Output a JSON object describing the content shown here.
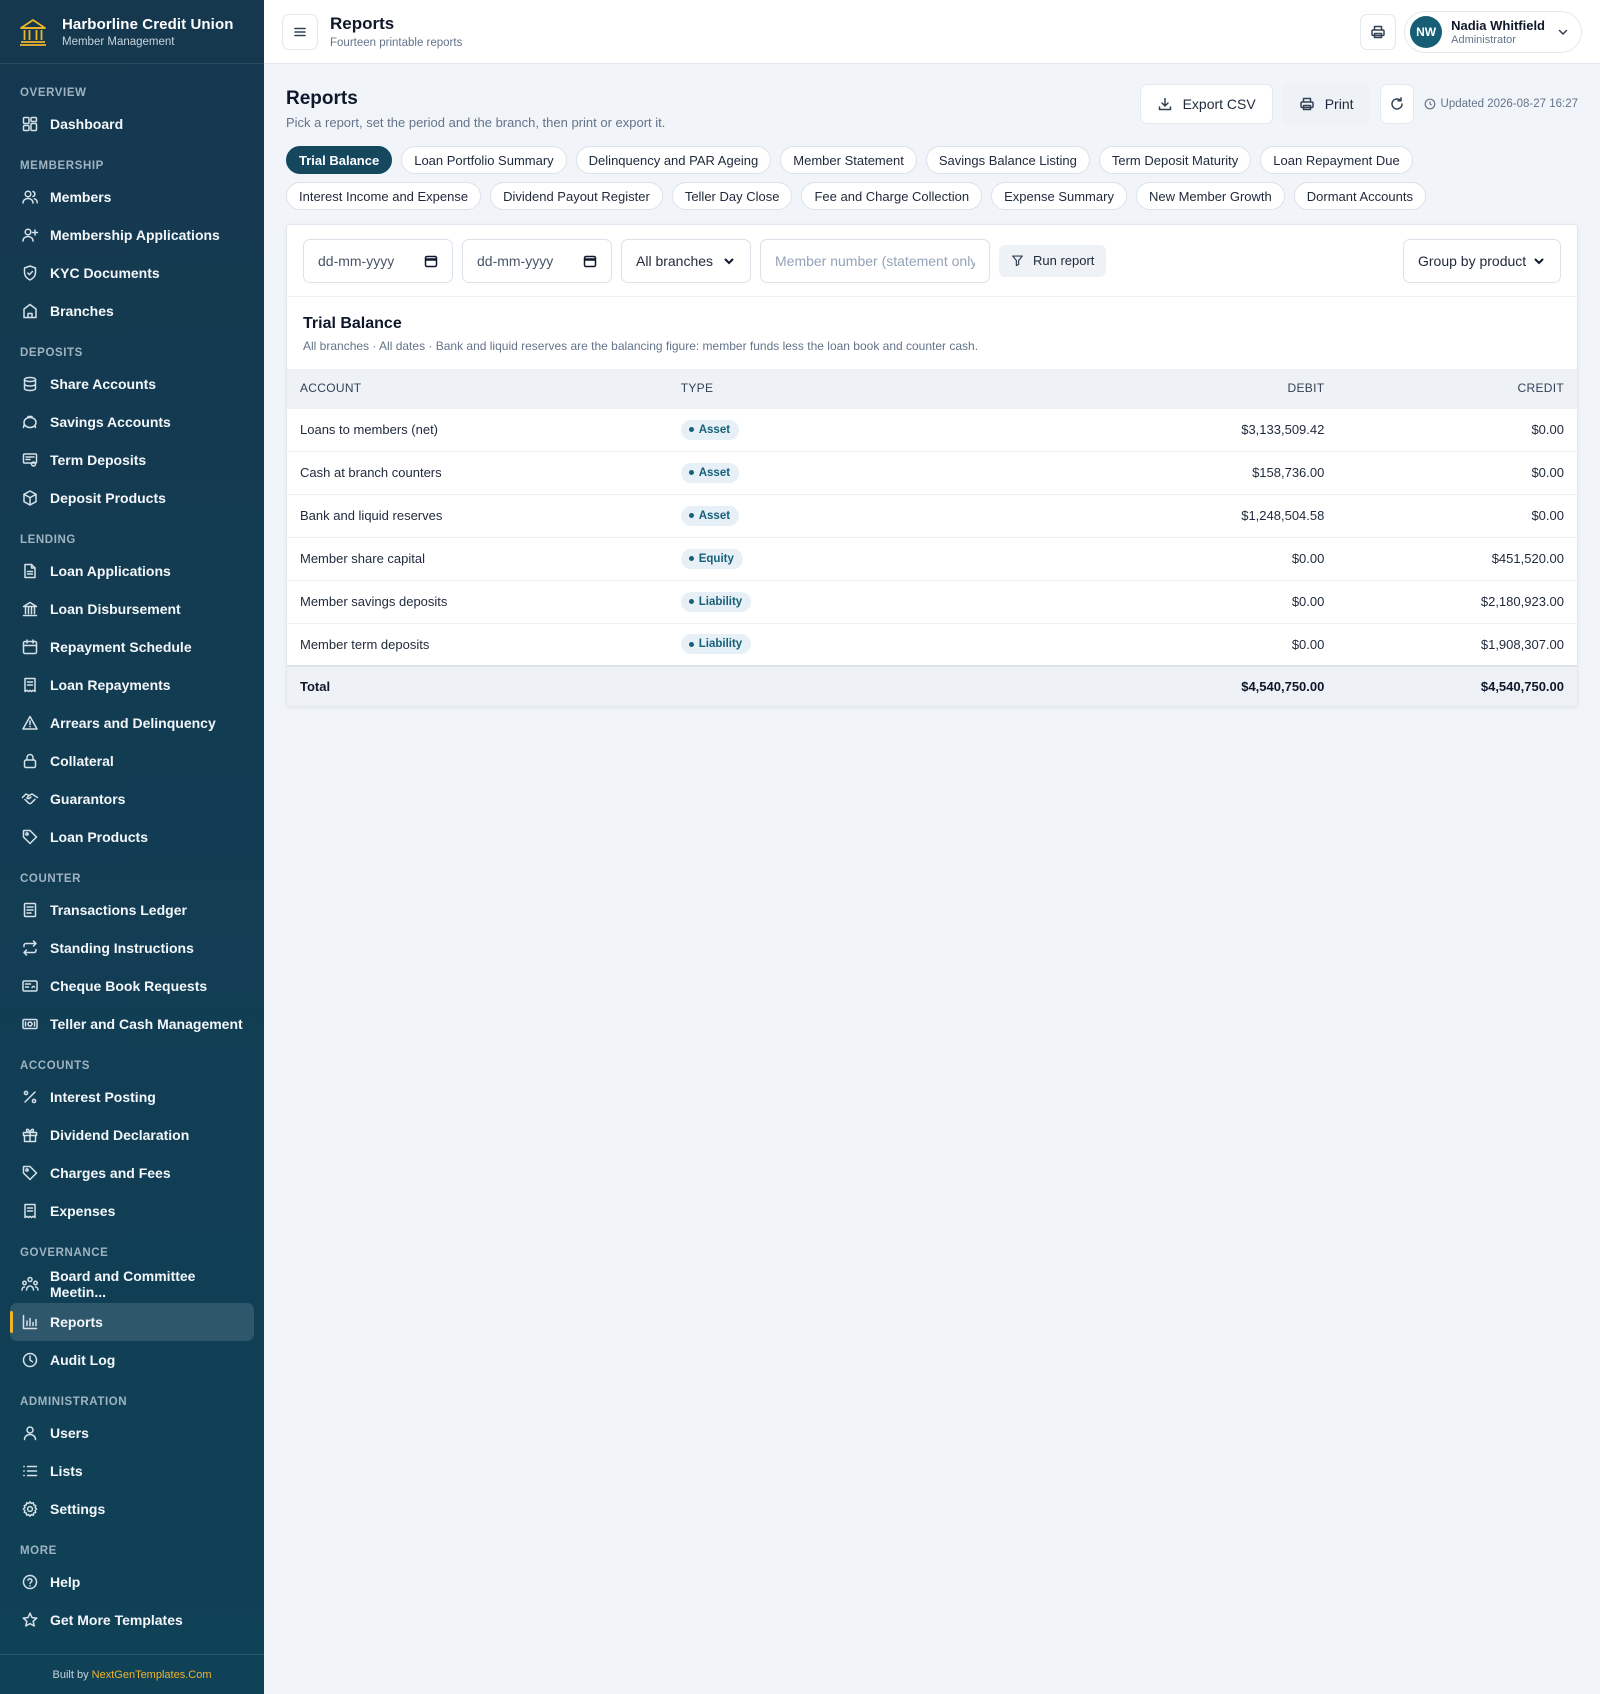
{
  "brand": {
    "name": "Harborline Credit Union",
    "subtitle": "Member Management"
  },
  "nav": [
    {
      "title": "Overview",
      "items": [
        {
          "label": "Dashboard",
          "icon": "dashboard-icon"
        }
      ]
    },
    {
      "title": "Membership",
      "items": [
        {
          "label": "Members",
          "icon": "users-icon"
        },
        {
          "label": "Membership Applications",
          "icon": "user-plus-icon"
        },
        {
          "label": "KYC Documents",
          "icon": "shield-icon"
        },
        {
          "label": "Branches",
          "icon": "building-icon"
        }
      ]
    },
    {
      "title": "Deposits",
      "items": [
        {
          "label": "Share Accounts",
          "icon": "database-icon"
        },
        {
          "label": "Savings Accounts",
          "icon": "piggy-bank-icon"
        },
        {
          "label": "Term Deposits",
          "icon": "certificate-icon"
        },
        {
          "label": "Deposit Products",
          "icon": "package-icon"
        }
      ]
    },
    {
      "title": "Lending",
      "items": [
        {
          "label": "Loan Applications",
          "icon": "file-icon"
        },
        {
          "label": "Loan Disbursement",
          "icon": "bank-icon"
        },
        {
          "label": "Repayment Schedule",
          "icon": "calendar-icon"
        },
        {
          "label": "Loan Repayments",
          "icon": "receipt-icon"
        },
        {
          "label": "Arrears and Delinquency",
          "icon": "alert-triangle-icon"
        },
        {
          "label": "Collateral",
          "icon": "lock-icon"
        },
        {
          "label": "Guarantors",
          "icon": "handshake-icon"
        },
        {
          "label": "Loan Products",
          "icon": "tag-icon"
        }
      ]
    },
    {
      "title": "Counter",
      "items": [
        {
          "label": "Transactions Ledger",
          "icon": "ledger-icon"
        },
        {
          "label": "Standing Instructions",
          "icon": "repeat-icon"
        },
        {
          "label": "Cheque Book Requests",
          "icon": "cheque-icon"
        },
        {
          "label": "Teller and Cash Management",
          "icon": "cash-icon"
        }
      ]
    },
    {
      "title": "Accounts",
      "items": [
        {
          "label": "Interest Posting",
          "icon": "percent-icon"
        },
        {
          "label": "Dividend Declaration",
          "icon": "gift-icon"
        },
        {
          "label": "Charges and Fees",
          "icon": "tag-icon"
        },
        {
          "label": "Expenses",
          "icon": "receipt-icon"
        }
      ]
    },
    {
      "title": "Governance",
      "items": [
        {
          "label": "Board and Committee Meetin...",
          "icon": "meeting-icon"
        },
        {
          "label": "Reports",
          "icon": "bar-chart-icon",
          "active": true
        },
        {
          "label": "Audit Log",
          "icon": "clock-icon"
        }
      ]
    },
    {
      "title": "Administration",
      "items": [
        {
          "label": "Users",
          "icon": "user-icon"
        },
        {
          "label": "Lists",
          "icon": "list-icon"
        },
        {
          "label": "Settings",
          "icon": "gear-icon"
        }
      ]
    },
    {
      "title": "More",
      "items": [
        {
          "label": "Help",
          "icon": "help-icon"
        },
        {
          "label": "Get More Templates",
          "icon": "star-icon"
        }
      ]
    }
  ],
  "footer": {
    "prefix": "Built by ",
    "link": "NextGenTemplates.Com"
  },
  "topbar": {
    "title": "Reports",
    "subtitle": "Fourteen printable reports"
  },
  "user": {
    "initials": "NW",
    "name": "Nadia Whitfield",
    "role": "Administrator"
  },
  "page": {
    "title": "Reports",
    "description": "Pick a report, set the period and the branch, then print or export it.",
    "export_label": "Export CSV",
    "print_label": "Print",
    "updated": "Updated 2026-08-27 16:27"
  },
  "report_tabs": [
    {
      "label": "Trial Balance",
      "active": true
    },
    {
      "label": "Loan Portfolio Summary"
    },
    {
      "label": "Delinquency and PAR Ageing"
    },
    {
      "label": "Member Statement"
    },
    {
      "label": "Savings Balance Listing"
    },
    {
      "label": "Term Deposit Maturity"
    },
    {
      "label": "Loan Repayment Due"
    },
    {
      "label": "Interest Income and Expense"
    },
    {
      "label": "Dividend Payout Register"
    },
    {
      "label": "Teller Day Close"
    },
    {
      "label": "Fee and Charge Collection"
    },
    {
      "label": "Expense Summary"
    },
    {
      "label": "New Member Growth"
    },
    {
      "label": "Dormant Accounts"
    }
  ],
  "filters": {
    "date_from": "dd-mm-yyyy",
    "date_to": "dd-mm-yyyy",
    "branch": "All branches",
    "member_placeholder": "Member number (statement only)",
    "run_label": "Run report",
    "group_by": "Group by product"
  },
  "report": {
    "title": "Trial Balance",
    "description": "All branches · All dates · Bank and liquid reserves are the balancing figure: member funds less the loan book and counter cash.",
    "columns": {
      "account": "Account",
      "type": "Type",
      "debit": "Debit",
      "credit": "Credit"
    },
    "rows": [
      {
        "account": "Loans to members (net)",
        "type": "Asset",
        "debit": "$3,133,509.42",
        "credit": "$0.00"
      },
      {
        "account": "Cash at branch counters",
        "type": "Asset",
        "debit": "$158,736.00",
        "credit": "$0.00"
      },
      {
        "account": "Bank and liquid reserves",
        "type": "Asset",
        "debit": "$1,248,504.58",
        "credit": "$0.00"
      },
      {
        "account": "Member share capital",
        "type": "Equity",
        "debit": "$0.00",
        "credit": "$451,520.00"
      },
      {
        "account": "Member savings deposits",
        "type": "Liability",
        "debit": "$0.00",
        "credit": "$2,180,923.00"
      },
      {
        "account": "Member term deposits",
        "type": "Liability",
        "debit": "$0.00",
        "credit": "$1,908,307.00"
      }
    ],
    "total": {
      "label": "Total",
      "debit": "$4,540,750.00",
      "credit": "$4,540,750.00"
    }
  },
  "colors": {
    "sidebar": "#15384f",
    "accent": "#f0b429",
    "primary": "#15475f"
  }
}
